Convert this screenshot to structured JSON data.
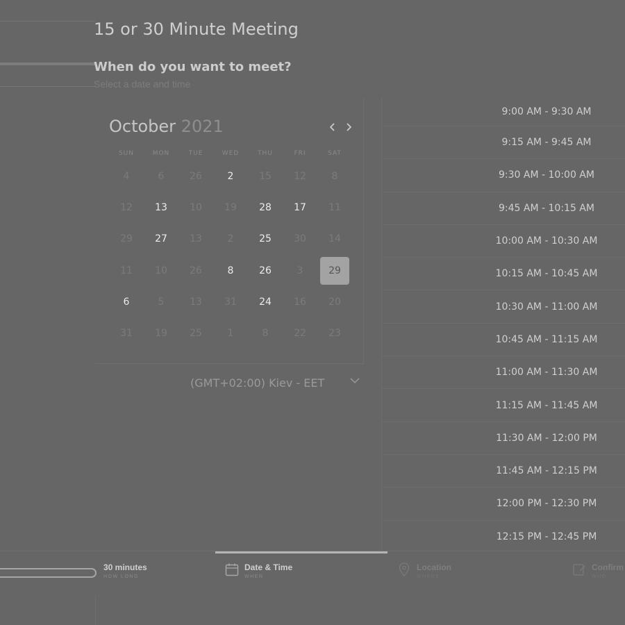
{
  "page_title": "15 or 30 Minute Meeting",
  "section": {
    "title": "When do you want to meet?",
    "subtitle": "Select a date and time"
  },
  "calendar": {
    "month": "October",
    "year": "2021",
    "prev_icon": "chevron-left-icon",
    "next_icon": "chevron-right-icon",
    "weekdays": [
      "SUN",
      "MON",
      "TUE",
      "WED",
      "THU",
      "FRI",
      "SAT"
    ],
    "days": [
      {
        "n": "4",
        "a": false
      },
      {
        "n": "6",
        "a": false
      },
      {
        "n": "26",
        "a": false
      },
      {
        "n": "2",
        "a": true
      },
      {
        "n": "15",
        "a": false
      },
      {
        "n": "12",
        "a": false
      },
      {
        "n": "8",
        "a": false
      },
      {
        "n": "12",
        "a": false
      },
      {
        "n": "13",
        "a": true
      },
      {
        "n": "10",
        "a": false
      },
      {
        "n": "19",
        "a": false
      },
      {
        "n": "28",
        "a": true
      },
      {
        "n": "17",
        "a": true
      },
      {
        "n": "11",
        "a": false
      },
      {
        "n": "29",
        "a": false
      },
      {
        "n": "27",
        "a": true
      },
      {
        "n": "13",
        "a": false
      },
      {
        "n": "2",
        "a": false
      },
      {
        "n": "25",
        "a": true
      },
      {
        "n": "30",
        "a": false
      },
      {
        "n": "14",
        "a": false
      },
      {
        "n": "11",
        "a": false
      },
      {
        "n": "10",
        "a": false
      },
      {
        "n": "26",
        "a": false
      },
      {
        "n": "8",
        "a": true
      },
      {
        "n": "26",
        "a": true
      },
      {
        "n": "3",
        "a": false
      },
      {
        "n": "29",
        "a": true,
        "selected": true
      },
      {
        "n": "6",
        "a": true
      },
      {
        "n": "5",
        "a": false
      },
      {
        "n": "13",
        "a": false
      },
      {
        "n": "31",
        "a": false
      },
      {
        "n": "24",
        "a": true
      },
      {
        "n": "16",
        "a": false
      },
      {
        "n": "20",
        "a": false
      },
      {
        "n": "31",
        "a": false
      },
      {
        "n": "19",
        "a": false
      },
      {
        "n": "25",
        "a": false
      },
      {
        "n": "1",
        "a": false
      },
      {
        "n": "8",
        "a": false
      },
      {
        "n": "22",
        "a": false
      },
      {
        "n": "23",
        "a": false
      }
    ],
    "selected_day": "29"
  },
  "timezone": {
    "label": "(GMT+02:00) Kiev - EET",
    "icon": "chevron-down-icon"
  },
  "time_slots": [
    "9:00 AM - 9:30 AM",
    "9:15 AM - 9:45 AM",
    "9:30 AM - 10:00 AM",
    "9:45 AM - 10:15 AM",
    "10:00 AM - 10:30 AM",
    "10:15 AM - 10:45 AM",
    "10:30 AM - 11:00 AM",
    "10:45 AM - 11:15 AM",
    "11:00 AM - 11:30 AM",
    "11:15 AM - 11:45 AM",
    "11:30 AM - 12:00 PM",
    "11:45 AM - 12:15 PM",
    "12:00 PM - 12:30 PM",
    "12:15 PM - 12:45 PM"
  ],
  "steps": {
    "duration": {
      "title": "30 minutes",
      "sub": "HOW LONG"
    },
    "datetime": {
      "title": "Date & Time",
      "sub": "WHEN",
      "icon": "calendar-icon"
    },
    "location": {
      "title": "Location",
      "sub": "WHERE",
      "icon": "location-pin-icon"
    },
    "confirm": {
      "title": "Confirm",
      "sub": "WHO",
      "icon": "edit-icon"
    }
  },
  "colors": {
    "background": "#666666",
    "selected_day": "#a3a3a3",
    "active_step_bar": "#b5b5b5"
  }
}
